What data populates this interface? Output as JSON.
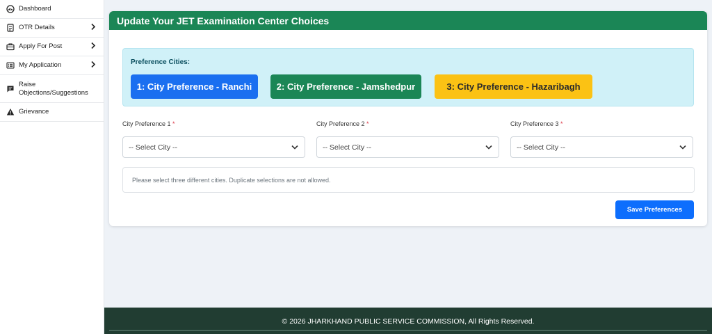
{
  "sidebar": {
    "items": [
      {
        "label": "Dashboard",
        "icon": "dashboard-icon"
      },
      {
        "label": "OTR Details",
        "icon": "id-card-icon"
      },
      {
        "label": "Apply For Post",
        "icon": "briefcase-icon"
      },
      {
        "label": "My Application",
        "icon": "list-icon"
      },
      {
        "label": "Raise Objections/Suggestions",
        "icon": "comment-icon"
      },
      {
        "label": "Grievance",
        "icon": "warning-icon"
      }
    ]
  },
  "card": {
    "title": "Update Your JET Examination Center Choices",
    "preference_title": "Preference Cities:",
    "chips": [
      "1: City Preference - Ranchi",
      "2: City Preference - Jamshedpur",
      "3: City Preference - Hazaribagh"
    ],
    "fields": [
      {
        "label": "City Preference 1",
        "value": "-- Select City --"
      },
      {
        "label": "City Preference 2",
        "value": "-- Select City --"
      },
      {
        "label": "City Preference 3",
        "value": "-- Select City --"
      }
    ],
    "required_marker": "*",
    "note": "Please select three different cities. Duplicate selections are not allowed.",
    "save_label": "Save Preferences"
  },
  "footer": {
    "text": "© 2026 JHARKHAND PUBLIC SERVICE COMMISSION, All Rights Reserved."
  },
  "colors": {
    "header_green": "#1b8656",
    "chip_blue": "#1a6ff0",
    "chip_yellow": "#fbc214",
    "button_blue": "#0d6efd",
    "footer_green": "#213d32"
  }
}
